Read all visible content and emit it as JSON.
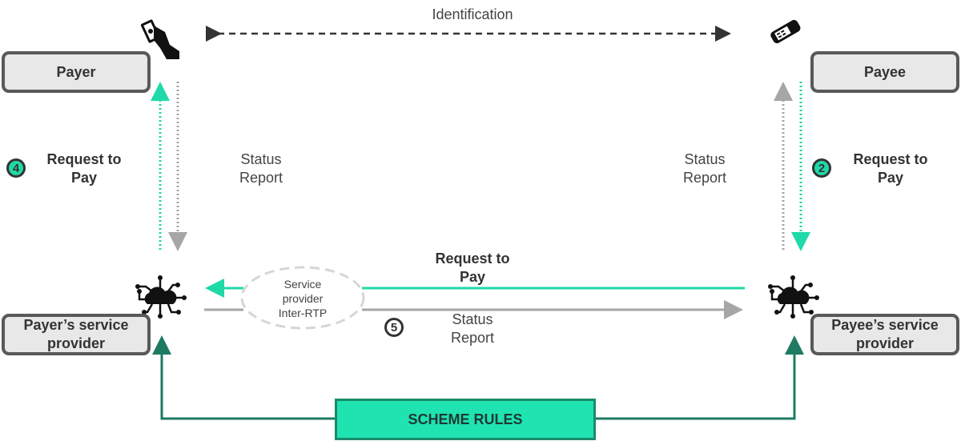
{
  "colors": {
    "teal": "#20d9a8",
    "dark_green": "#1f7a63",
    "gray": "#a6a6a6",
    "box_fill": "#e8e8e8",
    "scheme_fill": "#20e3b2"
  },
  "top": {
    "identification": "Identification",
    "payer_icon": "hand-with-cash-icon",
    "payee_icon": "card-terminal-icon"
  },
  "boxes": {
    "payer": "Payer",
    "payee": "Payee",
    "payer_sp": "Payer’s service provider",
    "payee_sp": "Payee’s service provider"
  },
  "left": {
    "step": "4",
    "request_line1": "Request to",
    "request_line2": "Pay",
    "status_line1": "Status",
    "status_line2": "Report"
  },
  "right": {
    "step": "2",
    "request_line1": "Request to",
    "request_line2": "Pay",
    "status_line1": "Status",
    "status_line2": "Report"
  },
  "middle": {
    "request_line1": "Request to",
    "request_line2": "Pay",
    "step": "5",
    "status_line1": "Status",
    "status_line2": "Report",
    "inter_rtp_line1": "Service",
    "inter_rtp_line2": "provider",
    "inter_rtp_line3": "Inter-RTP"
  },
  "scheme_rules": "SCHEME RULES",
  "sp_icon": "cloud-network-icon"
}
